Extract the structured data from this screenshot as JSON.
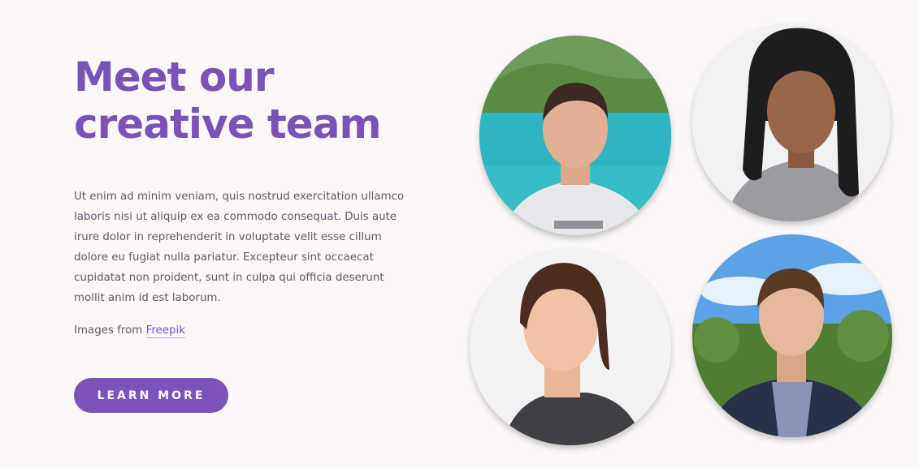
{
  "hero": {
    "heading_line1": "Meet our",
    "heading_line2": "creative team",
    "body": "Ut enim ad minim veniam, quis nostrud exercitation ullamco laboris nisi ut aliquip ex ea commodo consequat. Duis aute irure dolor in reprehenderit in voluptate velit esse cillum dolore eu fugiat nulla pariatur. Excepteur sint occaecat cupidatat non proident, sunt in culpa qui officia deserunt mollit anim id est laborum.",
    "credit_prefix": "Images from ",
    "credit_link": "Freepik",
    "cta_label": "LEARN MORE"
  },
  "colors": {
    "accent": "#7b53bb",
    "background": "#fbf8f7",
    "text": "#5f5868"
  },
  "team_photos": [
    {
      "name": "team-photo-man-lake"
    },
    {
      "name": "team-photo-woman-long-hair"
    },
    {
      "name": "team-photo-woman-smiling"
    },
    {
      "name": "team-photo-man-forest"
    }
  ]
}
